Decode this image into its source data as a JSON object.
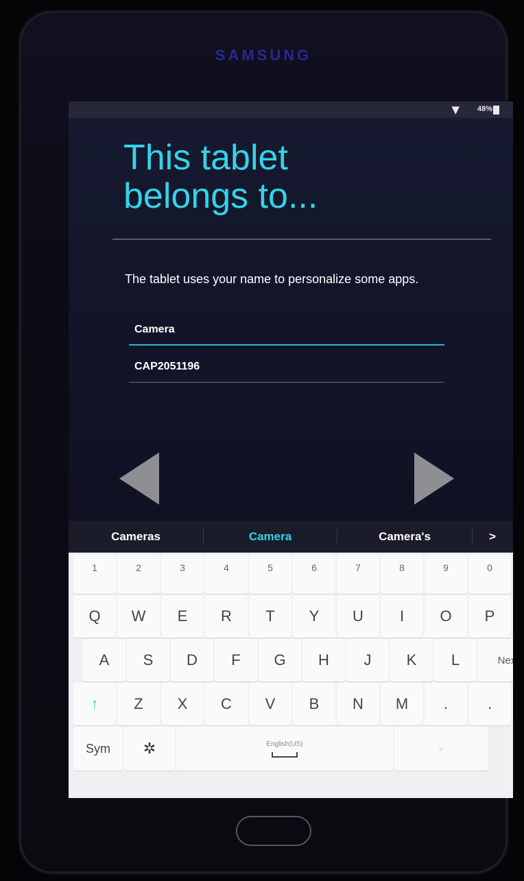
{
  "device": {
    "brand": "SAMSUNG"
  },
  "status_bar": {
    "signal_icon": "wifi-icon",
    "battery_text": "48%",
    "battery_icon": "battery-icon"
  },
  "screen": {
    "title_line1": "This tablet",
    "title_line2": "belongs to...",
    "description": "The tablet uses your name to personalize some apps.",
    "first_name_value": "Camera",
    "last_name_value": "CAP2051196"
  },
  "navigation": {
    "back_icon": "back-arrow-icon",
    "next_icon": "next-arrow-icon"
  },
  "suggestions": [
    "Cameras",
    "Camera",
    "Camera's",
    ">"
  ],
  "keyboard": {
    "numbers": [
      "1",
      "2",
      "3",
      "4",
      "5",
      "6",
      "7",
      "8",
      "9",
      "0"
    ],
    "row1": [
      "Q",
      "W",
      "E",
      "R",
      "T",
      "Y",
      "U",
      "I",
      "O",
      "P"
    ],
    "row2": [
      "A",
      "S",
      "D",
      "F",
      "G",
      "H",
      "J",
      "K",
      "L"
    ],
    "row2_next": "Next",
    "row3": [
      "Z",
      "X",
      "C",
      "V",
      "B",
      "N",
      "M",
      ".",
      "."
    ],
    "sym_label": "Sym",
    "space_label": "English(US)",
    "shift_glyph": "↑",
    "backspace_glyph": "⌫",
    "settings_glyph": "✲"
  }
}
